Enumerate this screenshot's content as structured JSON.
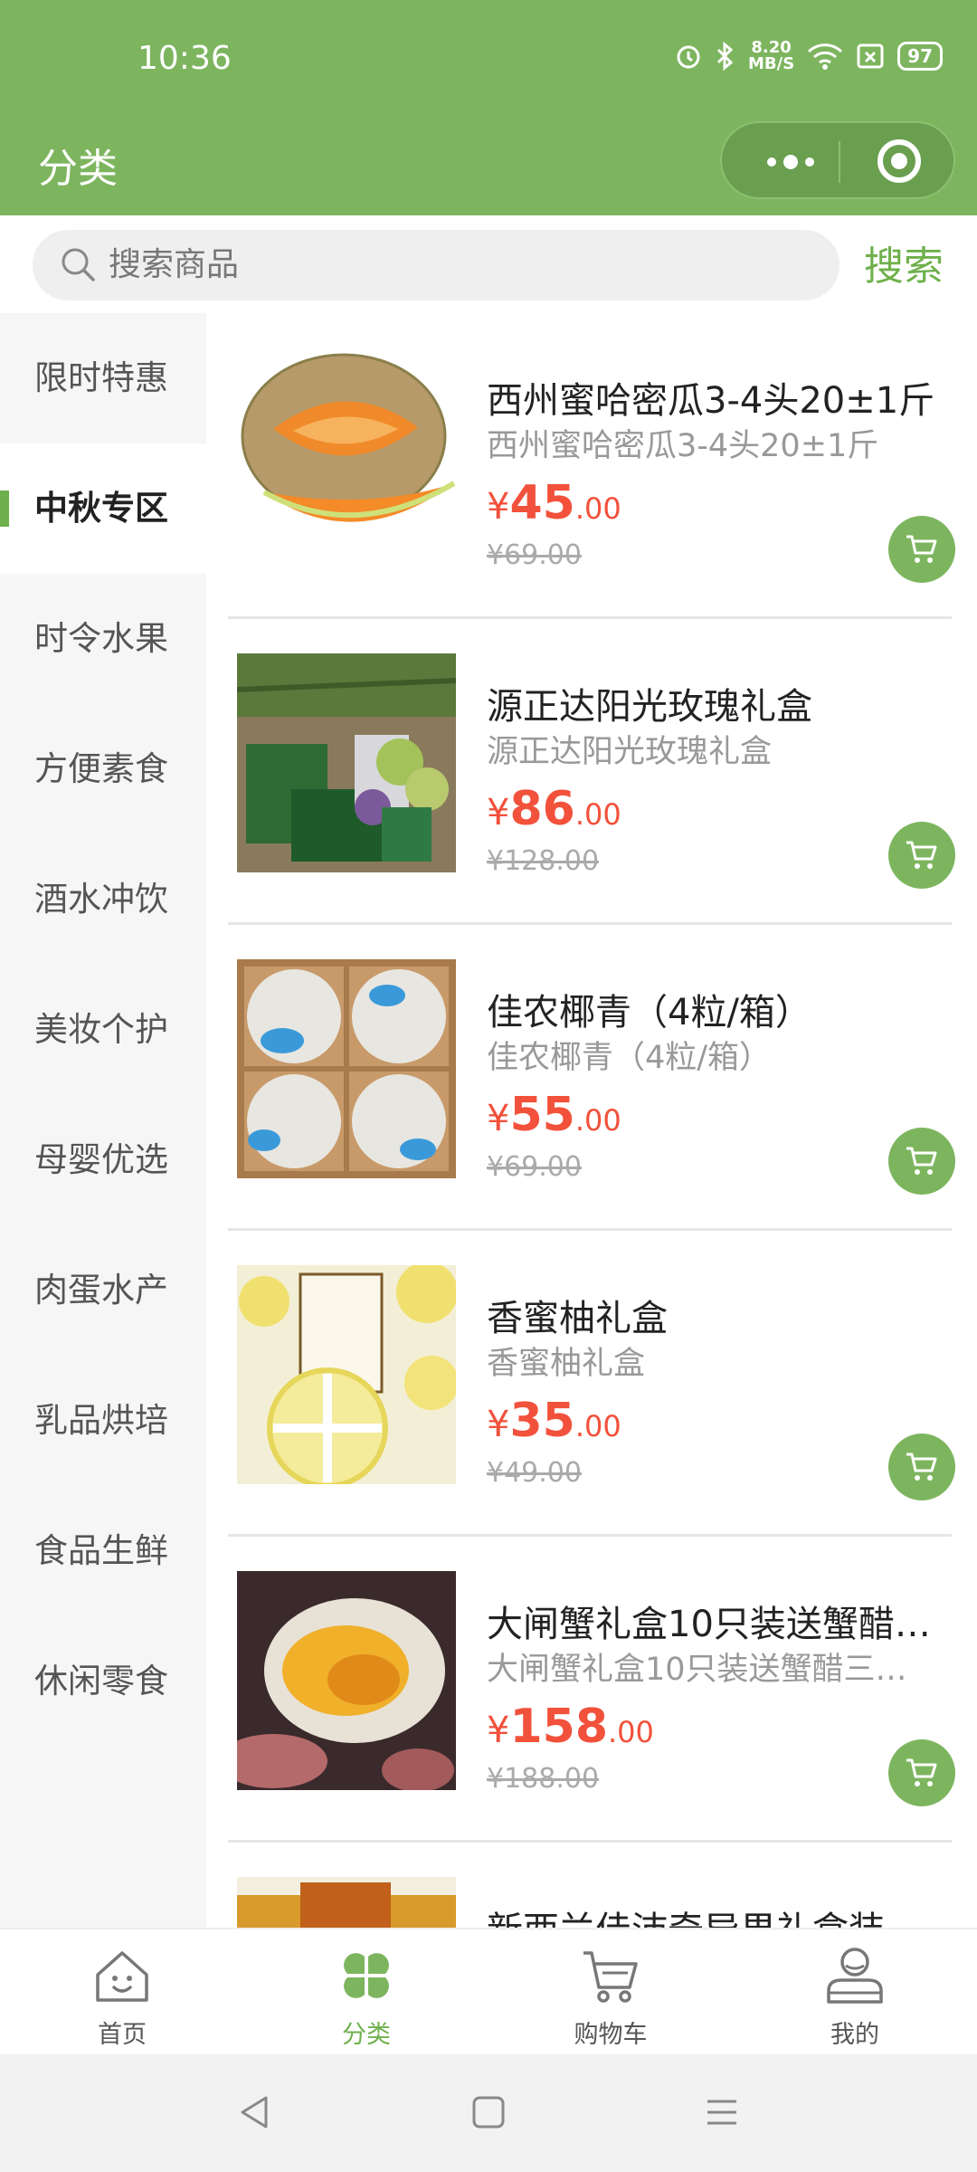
{
  "status": {
    "time": "10:36",
    "speed_top": "8.20",
    "speed_bottom": "MB/S",
    "battery": "97"
  },
  "header": {
    "title": "分类"
  },
  "search": {
    "placeholder": "搜索商品",
    "button": "搜索"
  },
  "sidebar": {
    "items": [
      {
        "label": "限时特惠",
        "active": false
      },
      {
        "label": "中秋专区",
        "active": true
      },
      {
        "label": "时令水果",
        "active": false
      },
      {
        "label": "方便素食",
        "active": false
      },
      {
        "label": "酒水冲饮",
        "active": false
      },
      {
        "label": "美妆个护",
        "active": false
      },
      {
        "label": "母婴优选",
        "active": false
      },
      {
        "label": "肉蛋水产",
        "active": false
      },
      {
        "label": "乳品烘培",
        "active": false
      },
      {
        "label": "食品生鲜",
        "active": false
      },
      {
        "label": "休闲零食",
        "active": false
      }
    ]
  },
  "products": [
    {
      "name": "西州蜜哈密瓜3-4头20±1斤",
      "desc": "西州蜜哈密瓜3-4头20±1斤",
      "currency": "¥",
      "price_int": "45",
      "price_dec": ".00",
      "orig": "¥69.00",
      "image": "cantaloupe-melon"
    },
    {
      "name": "源正达阳光玫瑰礼盒",
      "desc": "源正达阳光玫瑰礼盒",
      "currency": "¥",
      "price_int": "86",
      "price_dec": ".00",
      "orig": "¥128.00",
      "image": "grape-gift-box"
    },
    {
      "name": "佳农椰青（4粒/箱）",
      "desc": "佳农椰青（4粒/箱）",
      "currency": "¥",
      "price_int": "55",
      "price_dec": ".00",
      "orig": "¥69.00",
      "image": "coconut-box"
    },
    {
      "name": "香蜜柚礼盒",
      "desc": "香蜜柚礼盒",
      "currency": "¥",
      "price_int": "35",
      "price_dec": ".00",
      "orig": "¥49.00",
      "image": "pomelo-gift-box"
    },
    {
      "name": "大闸蟹礼盒10只装送蟹醋…",
      "desc": "大闸蟹礼盒10只装送蟹醋三…",
      "currency": "¥",
      "price_int": "158",
      "price_dec": ".00",
      "orig": "¥188.00",
      "image": "hairy-crab"
    },
    {
      "name": "新西兰佳沛奇异果礼盒装",
      "image": "kiwi-gift-box"
    }
  ],
  "tabbar": {
    "items": [
      {
        "label": "首页",
        "icon": "home-icon",
        "active": false
      },
      {
        "label": "分类",
        "icon": "clover-icon",
        "active": true
      },
      {
        "label": "购物车",
        "icon": "cart-icon",
        "active": false
      },
      {
        "label": "我的",
        "icon": "user-icon",
        "active": false
      }
    ]
  },
  "colors": {
    "accent": "#7db55f",
    "price": "#f2513b"
  }
}
